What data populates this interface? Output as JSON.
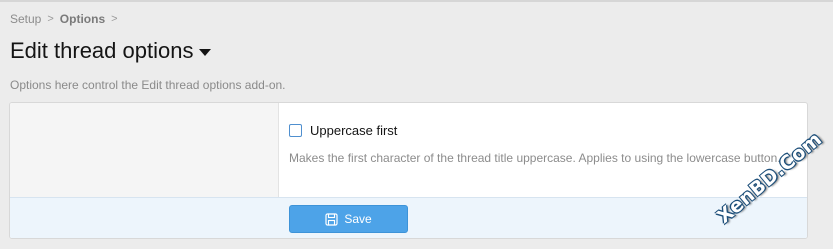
{
  "breadcrumb": {
    "items": [
      {
        "label": "Setup"
      },
      {
        "label": "Options"
      }
    ],
    "separator": ">"
  },
  "header": {
    "title": "Edit thread options",
    "description": "Options here control the Edit thread options add-on."
  },
  "options": {
    "uppercase_first": {
      "label": "Uppercase first",
      "checked": false,
      "hint": "Makes the first character of the thread title uppercase. Applies to using the lowercase button."
    }
  },
  "footer": {
    "save_label": "Save"
  },
  "watermark": {
    "text": "XenBD.Com"
  },
  "colors": {
    "accent": "#4da3e8",
    "footer_bg": "#edf5fc"
  }
}
